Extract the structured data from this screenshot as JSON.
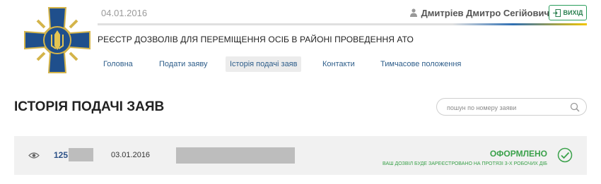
{
  "header": {
    "date": "04.01.2016",
    "user_name": "Дмитріев Дмитро Сегійович",
    "logout_label": "ВИХІД",
    "site_title": "РЕЄСТР ДОЗВОЛІВ ДЛЯ ПЕРЕМІЩЕННЯ ОСІБ В РАЙОНІ ПРОВЕДЕННЯ АТО",
    "accent_colors": {
      "blue": "#2f6fb3",
      "yellow": "#f2c500",
      "green": "#2a9d5c"
    }
  },
  "nav": {
    "items": [
      {
        "label": "Головна"
      },
      {
        "label": "Подати заяву"
      },
      {
        "label": "Історія подачі заяв",
        "active": true
      },
      {
        "label": "Контакти"
      },
      {
        "label": "Тимчасове положення"
      }
    ]
  },
  "main": {
    "heading": "ІСТОРІЯ ПОДАЧІ ЗАЯВ",
    "search": {
      "placeholder": "пошун по номеру заяви",
      "value": ""
    },
    "rows": [
      {
        "number_prefix": "125",
        "date": "03.01.2016",
        "status": "ОФОРМЛЕНО",
        "status_note": "ВАШ ДОЗВІЛ БУДЕ ЗАРЕЄСТРОВАНО НА ПРОТЯЗІ 3-Х РОБОЧИХ ДІБ",
        "status_color": "#3aa14a",
        "icons": [
          "eye-icon",
          "check-circle-icon"
        ]
      }
    ]
  }
}
